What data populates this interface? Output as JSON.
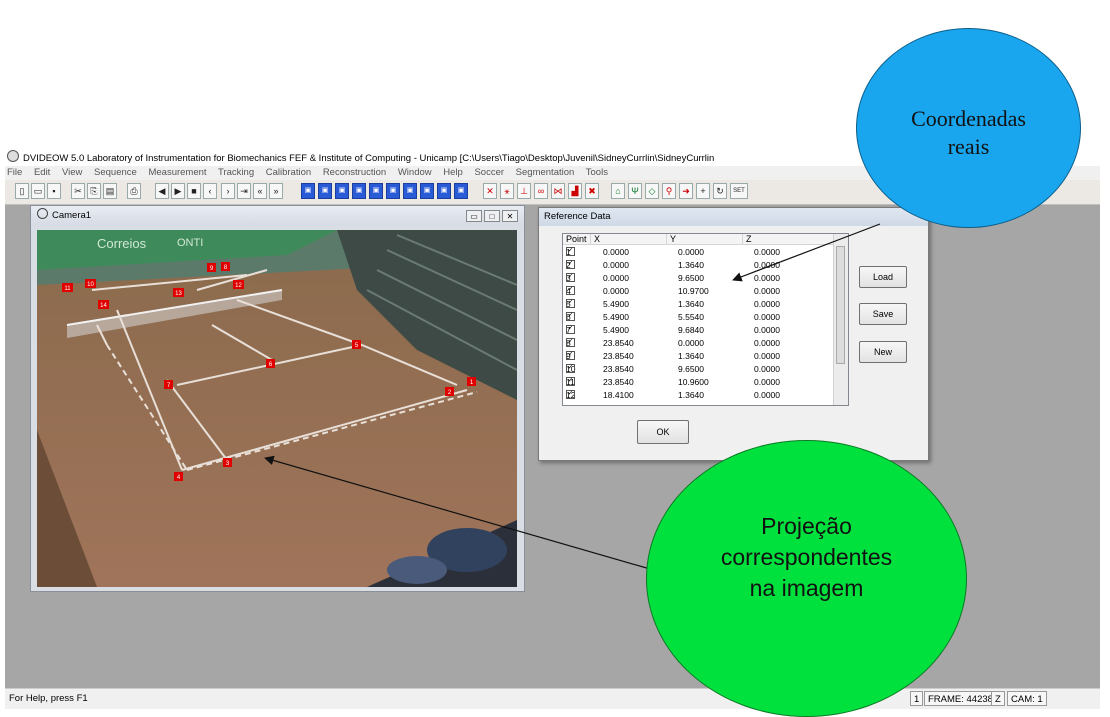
{
  "app": {
    "title": "DVIDEOW 5.0  Laboratory of Instrumentation for Biomechanics FEF & Institute of Computing - Unicamp [C:\\Users\\Tiago\\Desktop\\Juvenil\\SidneyCurrlin\\SidneyCurrlin",
    "menus": [
      "File",
      "Edit",
      "View",
      "Sequence",
      "Measurement",
      "Tracking",
      "Calibration",
      "Reconstruction",
      "Window",
      "Help",
      "Soccer",
      "Segmentation",
      "Tools"
    ]
  },
  "camera_window": {
    "title": "Camera1",
    "sign_text_1": "Correios",
    "sign_text_2": "ONTI",
    "markers": [
      "1",
      "2",
      "3",
      "4",
      "5",
      "6",
      "7",
      "8",
      "9",
      "10",
      "11",
      "12",
      "13",
      "14"
    ]
  },
  "reference_dialog": {
    "title": "Reference Data",
    "columns": [
      "Point",
      "X",
      "Y",
      "Z"
    ],
    "rows": [
      {
        "point": "1",
        "x": "0.0000",
        "y": "0.0000",
        "z": "0.0000"
      },
      {
        "point": "2",
        "x": "0.0000",
        "y": "1.3640",
        "z": "0.0000"
      },
      {
        "point": "3",
        "x": "0.0000",
        "y": "9.6500",
        "z": "0.0000"
      },
      {
        "point": "4",
        "x": "0.0000",
        "y": "10.9700",
        "z": "0.0000"
      },
      {
        "point": "5",
        "x": "5.4900",
        "y": "1.3640",
        "z": "0.0000"
      },
      {
        "point": "6",
        "x": "5.4900",
        "y": "5.5540",
        "z": "0.0000"
      },
      {
        "point": "7",
        "x": "5.4900",
        "y": "9.6840",
        "z": "0.0000"
      },
      {
        "point": "8",
        "x": "23.8540",
        "y": "0.0000",
        "z": "0.0000"
      },
      {
        "point": "9",
        "x": "23.8540",
        "y": "1.3640",
        "z": "0.0000"
      },
      {
        "point": "10",
        "x": "23.8540",
        "y": "9.6500",
        "z": "0.0000"
      },
      {
        "point": "11",
        "x": "23.8540",
        "y": "10.9600",
        "z": "0.0000"
      },
      {
        "point": "12",
        "x": "18.4100",
        "y": "1.3640",
        "z": "0.0000"
      }
    ],
    "checkbox_mark": "✓",
    "buttons": {
      "load": "Load",
      "save": "Save",
      "new": "New",
      "ok": "OK"
    }
  },
  "status_bar": {
    "help_text": "For Help, press F1",
    "cell_1": "1",
    "frame": "FRAME: 44238",
    "z": "Z",
    "cam": "CAM: 1"
  },
  "annotations": {
    "blue_text_line1": "Coordenadas",
    "blue_text_line2": "reais",
    "green_text_line1": "Projeção",
    "green_text_line2": "correspondentes",
    "green_text_line3": "na imagem",
    "blue_color": "#1aa6ef",
    "green_color": "#00e13e"
  }
}
